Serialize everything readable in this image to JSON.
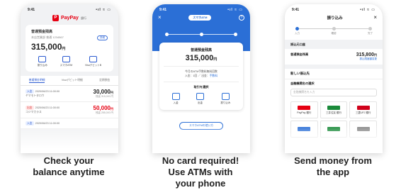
{
  "panels": [
    {
      "caption_line1": "Check your",
      "caption_line2": "balance anytime",
      "phone": {
        "time": "9:41",
        "signal": "•ıl ≈ ▭",
        "logo_mark": "P",
        "logo_name": "PayPay",
        "logo_sub": "銀行",
        "account_name": "普通預金残高",
        "account_number": "本店営業部 普通 1234567",
        "account_badge": "詳細",
        "balance": "315,000",
        "balance_unit": "円",
        "actions": [
          "振り込み",
          "スマホATM",
          "VisaデビットB"
        ],
        "tabs": [
          "普通預金明細",
          "Visaデビット明細",
          "定期預金"
        ],
        "transactions": [
          {
            "tag": "入金",
            "date": "2020/06/23 11:00:00",
            "name": "ヤマモトタロウ",
            "amount": "30,000",
            "unit": "円",
            "sub": "残高 315,000 円",
            "color": "black"
          },
          {
            "tag": "出金",
            "date": "2020/06/23 11:00:00",
            "name": "コジマカラス",
            "amount": "50,000",
            "unit": "円",
            "sub": "残高 285,000 円",
            "color": "red"
          },
          {
            "tag": "入金",
            "date": "2020/06/23 11:00:00",
            "name": "",
            "amount": "",
            "unit": "",
            "sub": "",
            "color": "black"
          }
        ]
      }
    },
    {
      "caption_line1": "No card required!",
      "caption_line2": "Use ATMs with",
      "caption_line3": "your phone",
      "phone": {
        "time": "9:41",
        "signal": "•ıl ≈ ▭",
        "close": "×",
        "pill": "スマホATM",
        "help": "?",
        "account_name": "普通預金残高",
        "balance": "315,000",
        "balance_unit": "円",
        "info_line1": "今月のATM手数料無料回数",
        "info_line2_prefix": "入金：1回 ／ 出金：",
        "info_line2_link": "手数料",
        "select_label": "取引を選択",
        "options": [
          "入金",
          "出金",
          "振り込み"
        ],
        "atm_link": "スマホATMの使い方"
      }
    },
    {
      "caption_line1": "Send money from",
      "caption_line2": "the app",
      "phone": {
        "time": "9:41",
        "signal": "•ıl ≈ ▭",
        "title": "振り込み",
        "close": "×",
        "steps": [
          "入力",
          "確認",
          "完了"
        ],
        "from_section": "振込元口座",
        "from_label": "普通預金残高",
        "from_value": "315,800",
        "from_unit": "円",
        "from_link": "振込限度額変更",
        "new_label": "新しい振込先",
        "bank_label": "金融機関名の選択",
        "bank_placeholder": "金融機関名を入力",
        "banks": [
          {
            "name": "PayPay\n銀行",
            "color": "#e60012"
          },
          {
            "name": "三井住友\n銀行",
            "color": "#1a8a3a"
          },
          {
            "name": "三菱UFJ\n銀行",
            "color": "#d0021b"
          },
          {
            "name": "",
            "color": "#2b6fd6"
          },
          {
            "name": "",
            "color": "#1a8a3a"
          },
          {
            "name": "",
            "color": "#888888"
          }
        ]
      }
    }
  ]
}
